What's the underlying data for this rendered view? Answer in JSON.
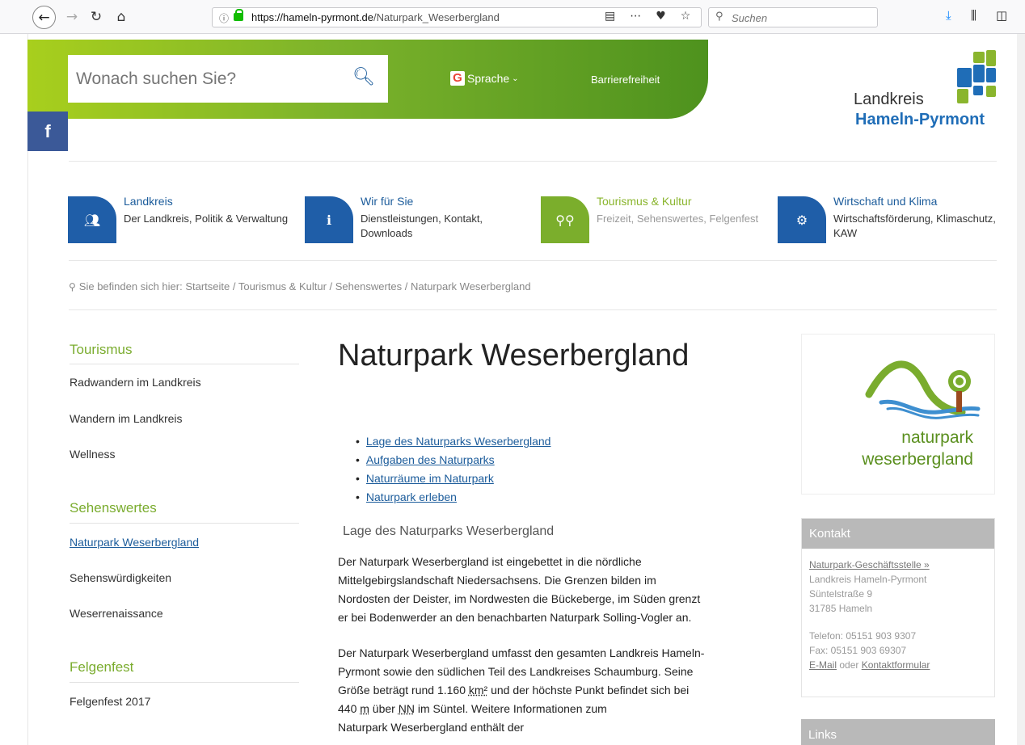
{
  "browser": {
    "url_host": "https://hameln-pyrmont.de",
    "url_path": "/Naturpark_Weserbergland",
    "search_placeholder": "Suchen"
  },
  "header": {
    "search_placeholder": "Wonach suchen Sie?",
    "language_label": "Sprache",
    "accessibility_label": "Barrierefreiheit",
    "facebook_label": "f",
    "logo_line1": "Landkreis",
    "logo_line2": "Hameln-Pyrmont"
  },
  "nav": [
    {
      "title": "Landkreis",
      "subtitle": "Der Landkreis, Politik & Verwaltung",
      "icon": "users-icon",
      "color": "#1f5ea8"
    },
    {
      "title": "Wir für Sie",
      "subtitle": "Dienstleistungen, Kontakt, Downloads",
      "icon": "info-icon",
      "color": "#1f5ea8"
    },
    {
      "title": "Tourismus & Kultur",
      "subtitle": "Freizeit, Sehenswertes, Felgenfest",
      "icon": "bicycle-icon",
      "color": "#7bae2c"
    },
    {
      "title": "Wirtschaft und Klima",
      "subtitle": "Wirtschaftsförderung, Klimaschutz, KAW",
      "icon": "gears-icon",
      "color": "#1f5ea8"
    }
  ],
  "breadcrumb": "Sie befinden sich hier: Startseite / Tourismus & Kultur / Sehenswertes / Naturpark Weserbergland",
  "sidebar": {
    "sections": [
      {
        "heading": "Tourismus",
        "items": [
          "Radwandern im Landkreis",
          "Wandern im Landkreis",
          "Wellness"
        ]
      },
      {
        "heading": "Sehenswertes",
        "items": [
          "Naturpark Weserbergland",
          "Sehenswürdigkeiten",
          "Weserrenaissance"
        ]
      },
      {
        "heading": "Felgenfest",
        "items": [
          "Felgenfest 2017"
        ]
      }
    ]
  },
  "main": {
    "title": "Naturpark Weserbergland",
    "toc": [
      "Lage des Naturparks Weserbergland",
      "Aufgaben des Naturparks",
      "Naturräume im Naturpark",
      "Naturpark erleben"
    ],
    "section_heading": "Lage des Naturparks Weserbergland",
    "para1": [
      "Der Naturpark Weserbergland ist eingebettet in die nördliche",
      "Mittelgebirgslandschaft Niedersachsens. Die Grenzen bilden im",
      "Nordosten der Deister, im Nordwesten die Bückeberge, im Süden grenzt",
      "er bei Bodenwerder an den benachbarten Naturpark Solling-Vogler an."
    ],
    "para2_line1": "Der Naturpark Weserbergland umfasst den gesamten Landkreis Hameln-",
    "para2_line2": "Pyrmont sowie den südlichen Teil des Landkreises Schaumburg. Seine",
    "para2_line3a": "Größe beträgt rund 1.160 ",
    "para2_km": "km²",
    "para2_line3b": " und der höchste Punkt befindet sich bei",
    "para2_line4a": "440 ",
    "para2_m": "m",
    "para2_line4b": " über ",
    "para2_nn": "NN",
    "para2_line4c": " im Süntel. Weitere Informationen zum",
    "para2_line5": "Naturpark Weserbergland enthält der"
  },
  "naturpark_logo": {
    "line1": "naturpark",
    "line2": "weserbergland"
  },
  "kontakt": {
    "heading": "Kontakt",
    "link": "Naturpark-Geschäftsstelle »",
    "address": [
      "Landkreis Hameln-Pyrmont",
      "Süntelstraße 9",
      "31785 Hameln"
    ],
    "phone": "Telefon: 05151 903 9307",
    "fax": "Fax: 05151 903 69307",
    "email_link": "E-Mail",
    "oder": " oder ",
    "form_link": "Kontaktformular"
  },
  "links_heading": "Links"
}
